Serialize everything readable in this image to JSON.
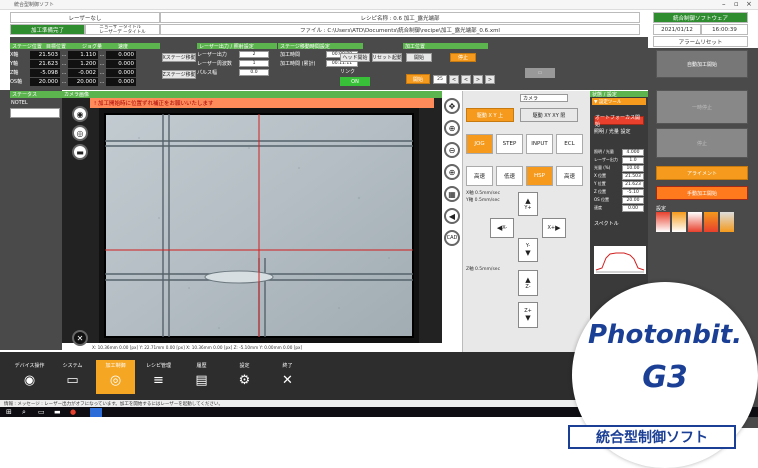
{
  "window": {
    "title": "統合型制御ソフト"
  },
  "header": {
    "chip_name": "レーザーなし",
    "layer_title": "ニョーサ ータイトル\nレーザーデ ータイトル",
    "recipe_title": "レシピ名称 : 0.6 加工_露光端部",
    "file_path": "ファイル : C:\\Users\\ATD\\Documents\\統合制御\\recipe\\加工_露光端部_0.6.xml",
    "app_label": "統合制御ソフトウェア",
    "date": "2021/01/12",
    "time": "16:00:39",
    "state_btn": "アラームリセット",
    "mode_label": "加工準備完了"
  },
  "axes": {
    "headers": [
      "ステージ位置",
      "目標位置",
      "ジョグ量",
      "速度"
    ],
    "rows": [
      {
        "name": "X軸",
        "pos": "21.503",
        "jog": "1.110",
        "spd": "0.000"
      },
      {
        "name": "Y軸",
        "pos": "21.623",
        "jog": "1.200",
        "spd": "0.000"
      },
      {
        "name": "Z軸",
        "pos": "-5.098",
        "jog": "-0.002",
        "spd": "0.000"
      },
      {
        "name": "OS軸",
        "pos": "20.000",
        "jog": "20.000",
        "spd": "0.000"
      }
    ],
    "move_btn_1": "Xステージ移動",
    "move_btn_2": "Zステージ移動"
  },
  "laser_settings": {
    "header": "レーザー出力 / 照射設定",
    "rows": [
      {
        "label": "レーザー出力",
        "value": "2"
      },
      {
        "label": "レーザー周波数",
        "value": "1"
      },
      {
        "label": "パルス幅",
        "value": "0.0"
      }
    ]
  },
  "timing": {
    "header": "ステージ移動時間設定",
    "rows": [
      {
        "label": "加工時間",
        "value": "00:00:00"
      },
      {
        "label": "加工時間 (累計)",
        "value": "00:11:11"
      }
    ],
    "start_label": "ヘッド開始",
    "reset_label": "リセット起動",
    "link_label": "リンク",
    "laser_on": "ON"
  },
  "cut": {
    "header": "加工位置",
    "btn1": "開始",
    "btn2": "停止",
    "step": "25"
  },
  "left_status": {
    "header": "ステータス",
    "item": "NOTEL"
  },
  "image": {
    "header": "カメラ画像",
    "banner": "! 加工開始時に位置ずれ補正をお願いいたします",
    "status": "X: 10.36mm 0.00 [px]  Y: 22.71mm 0.00 [px]  X: 10.36mm 0.00 [px]  Z: -5.10mm  Y: 0.00mm 0.00 [px]"
  },
  "camera_panel": {
    "select": "カメラ",
    "btn_xy": "駆動 X Y 上",
    "btn_xy2": "駆動 XY  XY 限",
    "tabs1": [
      "JOG",
      "STEP",
      "INPUT",
      "ECL"
    ],
    "tabs2": [
      "高速",
      "低速",
      "HSP",
      "高速"
    ],
    "spd1": "X軸 0.5mm/sec",
    "spd2": "Y軸 0.5mm/sec",
    "spd3": "Z軸 0.5mm/sec",
    "xy_up": "Y+",
    "xy_down": "Y-",
    "xy_left": "X-",
    "xy_right": "X+",
    "z_down": "Z-",
    "z_up": "Z+"
  },
  "right_panel": {
    "header": "状態 / 設定",
    "sub": "▼ 設定ツール",
    "auto_btn": "オートフォーカス開始",
    "label": "照明 / 光量 設定",
    "params": [
      {
        "label": "照明 / 光量",
        "value": "4.000"
      },
      {
        "label": "レーザー出力",
        "value": "1.0"
      },
      {
        "label": "光量 (%)",
        "value": "10.00"
      },
      {
        "label": "X 位置",
        "value": "21.503"
      },
      {
        "label": "Y 位置",
        "value": "21.623"
      },
      {
        "label": "Z 位置",
        "value": "-5.10"
      },
      {
        "label": "OS 位置",
        "value": "20.00"
      },
      {
        "label": "速度",
        "value": "0.00"
      }
    ],
    "graph_label": "スペクトル",
    "option": "設定"
  },
  "side_buttons": {
    "auto": "自動加工開始",
    "pause": "一時停止",
    "stop": "停止",
    "align": "アライメント",
    "manual": "手動加工開始"
  },
  "nav": [
    {
      "label": "デバイス操作",
      "icon": "◉"
    },
    {
      "label": "システム",
      "icon": "▭"
    },
    {
      "label": "加工制御",
      "icon": "◎"
    },
    {
      "label": "レシピ管理",
      "icon": "≡"
    },
    {
      "label": "履歴",
      "icon": "▤"
    },
    {
      "label": "設定",
      "icon": "⚙"
    },
    {
      "label": "終了",
      "icon": "✕"
    }
  ],
  "statusbar": "情報 : メッセージ : レーザー出力がオフになっています。加工を開始するにはレーザーを起動してください。",
  "brand": {
    "line1": "Photonbit.",
    "line2": "G3",
    "caption": "統合型制御ソフト"
  }
}
